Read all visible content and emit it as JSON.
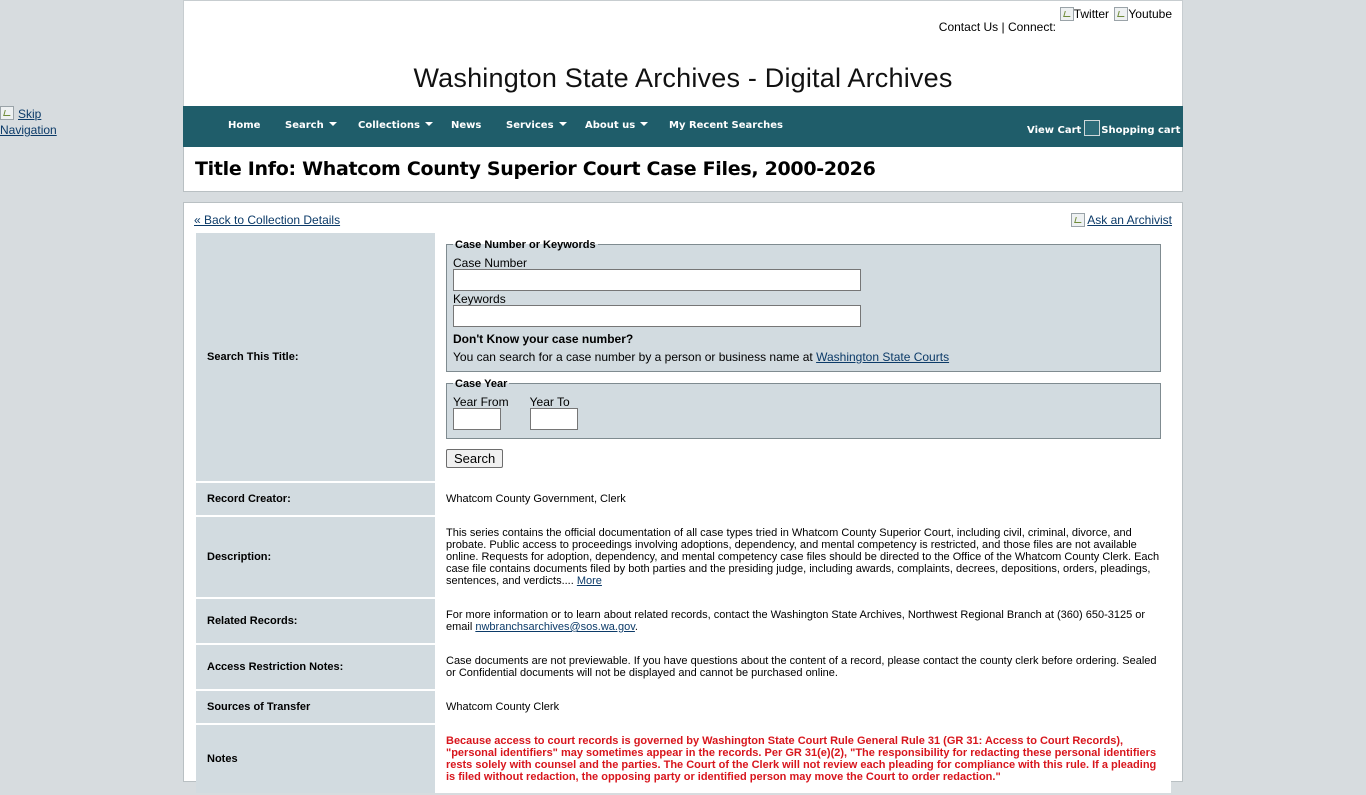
{
  "skip_nav": {
    "label": "Skip Navigation"
  },
  "header": {
    "contact_us": "Contact Us",
    "separator": "|",
    "connect": "Connect:",
    "twitter": "Twitter",
    "youtube": "Youtube",
    "site_title": "Washington State Archives - Digital Archives"
  },
  "nav": {
    "home": "Home",
    "search": "Search",
    "collections": "Collections",
    "news": "News",
    "services": "Services",
    "about": "About us",
    "recent": "My Recent Searches",
    "view_cart": "View Cart",
    "cart_img_alt": "Shopping cart"
  },
  "page_title": "Title Info: Whatcom County Superior Court Case Files, 2000-2026",
  "links": {
    "back": "« Back to Collection Details",
    "ask": "Ask an Archivist"
  },
  "search_form": {
    "row_label": "Search This Title:",
    "legend_case": "Case Number or Keywords",
    "case_number_label": "Case Number",
    "case_number_value": "",
    "keywords_label": "Keywords",
    "keywords_value": "",
    "dont_know": "Don't Know your case number?",
    "hint_text": "You can search for a case number by a person or business name at",
    "hint_link": "Washington State Courts",
    "legend_year": "Case Year",
    "year_from_label": "Year From",
    "year_from_value": "",
    "year_to_label": "Year To",
    "year_to_value": "",
    "search_button": "Search"
  },
  "rows": {
    "creator_label": "Record Creator:",
    "creator_value": "Whatcom County Government, Clerk",
    "description_label": "Description:",
    "description_value": "This series contains the official documentation of all case types tried in Whatcom County Superior Court, including civil, criminal, divorce, and probate. Public access to proceedings involving adoptions, dependency, and mental competency is restricted, and those files are not available online. Requests for adoption, dependency, and mental competency case files should be directed to the Office of the Whatcom County Clerk. Each case file contains documents filed by both parties and the presiding judge, including awards, complaints, decrees, depositions, orders, pleadings, sentences, and verdicts....",
    "description_more": "More",
    "related_label": "Related Records:",
    "related_value": "For more information or to learn about related records, contact the Washington State Archives, Northwest Regional Branch at (360) 650-3125 or email",
    "related_email": "nwbranchsarchives@sos.wa.gov",
    "related_end": ".",
    "access_label": "Access Restriction Notes:",
    "access_value": "Case documents are not previewable. If you have questions about the content of a record, please contact the county clerk before ordering. Sealed or Confidential documents will not be displayed and cannot be purchased online.",
    "sources_label": "Sources of Transfer",
    "sources_value": "Whatcom County Clerk",
    "notes_label": "Notes",
    "notes_value": "Because access to court records is governed by Washington State Court Rule General Rule 31 (GR 31: Access to Court Records), \"personal identifiers\" may sometimes appear in the records. Per GR 31(e)(2), \"The responsibility for redacting these personal identifiers rests solely with counsel and the parties. The Court of the Clerk will not review each pleading for compliance with this rule. If a pleading is filed without redaction, the opposing party or identified person may move the Court to order redaction.\""
  },
  "colors": {
    "nav_bg": "#1f5d6a",
    "label_bg": "#d2dbe0",
    "page_bg": "#d7dcdf",
    "notes_red": "#d8161d",
    "link": "#0b3a68"
  }
}
